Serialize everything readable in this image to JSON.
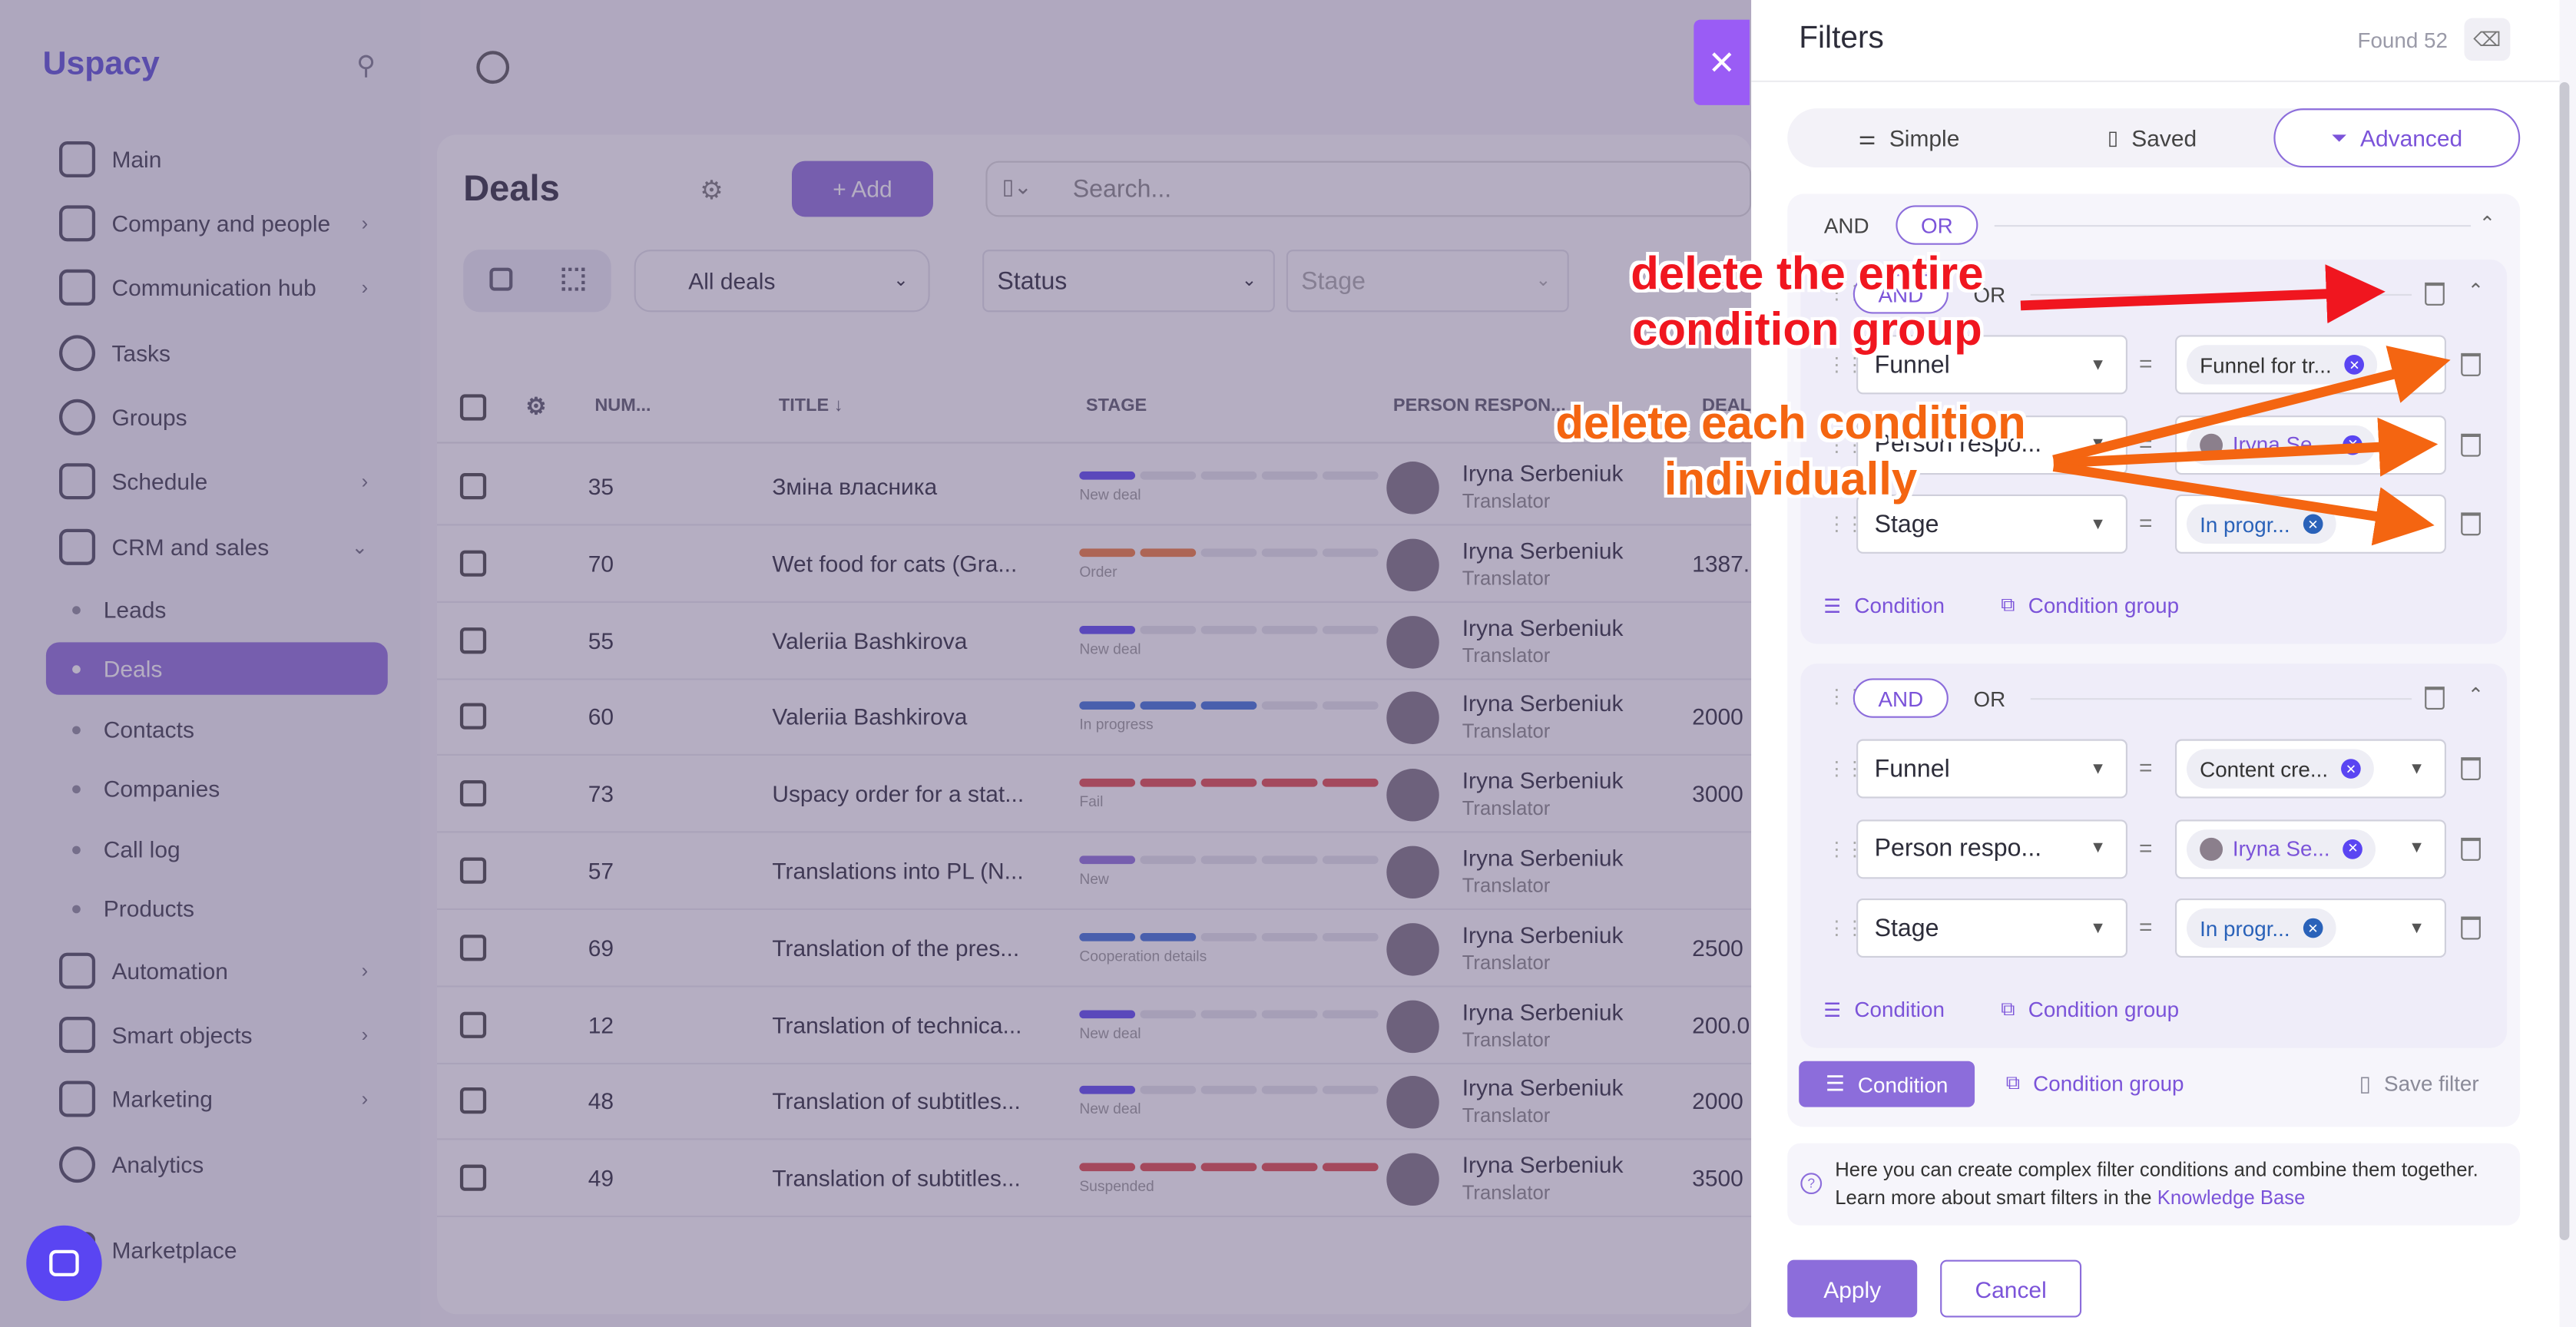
{
  "sidebar": {
    "logo": "Uspacy",
    "items": [
      {
        "label": "Main",
        "icon": "home-icon",
        "chevron": false
      },
      {
        "label": "Company and people",
        "icon": "company-icon",
        "chevron": true
      },
      {
        "label": "Communication hub",
        "icon": "chat-icon",
        "chevron": true
      },
      {
        "label": "Tasks",
        "icon": "tasks-icon",
        "chevron": false
      },
      {
        "label": "Groups",
        "icon": "groups-icon",
        "chevron": false
      },
      {
        "label": "Schedule",
        "icon": "calendar-icon",
        "chevron": true
      },
      {
        "label": "CRM and sales",
        "icon": "database-icon",
        "chevron": true
      }
    ],
    "crm_sub": [
      "Leads",
      "Deals",
      "Contacts",
      "Companies",
      "Call log",
      "Products"
    ],
    "items_bottom": [
      {
        "label": "Automation",
        "icon": "lightning-icon"
      },
      {
        "label": "Smart objects",
        "icon": "smart-objects-icon"
      },
      {
        "label": "Marketing",
        "icon": "marketing-icon"
      },
      {
        "label": "Analytics",
        "icon": "analytics-icon"
      },
      {
        "label": "Marketplace",
        "icon": "marketplace-icon"
      }
    ]
  },
  "main": {
    "title": "Deals",
    "add_label": "+ Add",
    "search_placeholder": "Search...",
    "view_filter": "All deals",
    "status_filter": "Status",
    "stage_filter": "Stage",
    "columns": [
      "NUM...",
      "TITLE ↓",
      "STAGE",
      "PERSON RESPON...",
      "DEAL"
    ],
    "rows": [
      {
        "num": "35",
        "title": "Зміна власника",
        "stage": "New deal",
        "person": "Iryna Serbeniuk",
        "role": "Translator",
        "amount": ""
      },
      {
        "num": "70",
        "title": "Wet food for cats (Gra...",
        "stage": "Order",
        "person": "Iryna Serbeniuk",
        "role": "Translator",
        "amount": "1387."
      },
      {
        "num": "55",
        "title": "Valeriia Bashkirova",
        "stage": "New deal",
        "person": "Iryna Serbeniuk",
        "role": "Translator",
        "amount": ""
      },
      {
        "num": "60",
        "title": "Valeriia Bashkirova",
        "stage": "In progress",
        "person": "Iryna Serbeniuk",
        "role": "Translator",
        "amount": "2000"
      },
      {
        "num": "73",
        "title": "Uspacy order for a stat...",
        "stage": "Fail",
        "person": "Iryna Serbeniuk",
        "role": "Translator",
        "amount": "3000"
      },
      {
        "num": "57",
        "title": "Translations into PL (N...",
        "stage": "New",
        "person": "Iryna Serbeniuk",
        "role": "Translator",
        "amount": ""
      },
      {
        "num": "69",
        "title": "Translation of the pres...",
        "stage": "Cooperation details",
        "person": "Iryna Serbeniuk",
        "role": "Translator",
        "amount": "2500"
      },
      {
        "num": "12",
        "title": "Translation of technica...",
        "stage": "New deal",
        "person": "Iryna Serbeniuk",
        "role": "Translator",
        "amount": "200.0"
      },
      {
        "num": "48",
        "title": "Translation of subtitles...",
        "stage": "New deal",
        "person": "Iryna Serbeniuk",
        "role": "Translator",
        "amount": "2000"
      },
      {
        "num": "49",
        "title": "Translation of subtitles...",
        "stage": "Suspended",
        "person": "Iryna Serbeniuk",
        "role": "Translator",
        "amount": "3500"
      }
    ]
  },
  "filters": {
    "title": "Filters",
    "found": "Found 52",
    "tabs": [
      "Simple",
      "Saved",
      "Advanced"
    ],
    "and_label": "AND",
    "or_label": "OR",
    "group1": {
      "conditions": [
        {
          "field": "Funnel",
          "value": "Funnel for tr..."
        },
        {
          "field": "Person respo...",
          "value": "Iryna Se..."
        },
        {
          "field": "Stage",
          "value": "In progr..."
        }
      ]
    },
    "group2": {
      "conditions": [
        {
          "field": "Funnel",
          "value": "Content cre..."
        },
        {
          "field": "Person respo...",
          "value": "Iryna Se..."
        },
        {
          "field": "Stage",
          "value": "In progr..."
        }
      ]
    },
    "condition_label": "Condition",
    "condition_group_label": "Condition group",
    "save_filter": "Save filter",
    "help_text": "Here you can create complex filter conditions and combine them together. Learn more about smart filters in the ",
    "help_link": "Knowledge Base",
    "apply": "Apply",
    "cancel": "Cancel"
  },
  "annotations": {
    "red": "delete the entire condition group",
    "orange": "delete each condition individually"
  },
  "colors": {
    "accent": "#8c6ddb",
    "annotation_red": "#f0161f",
    "annotation_orange": "#f46511"
  }
}
